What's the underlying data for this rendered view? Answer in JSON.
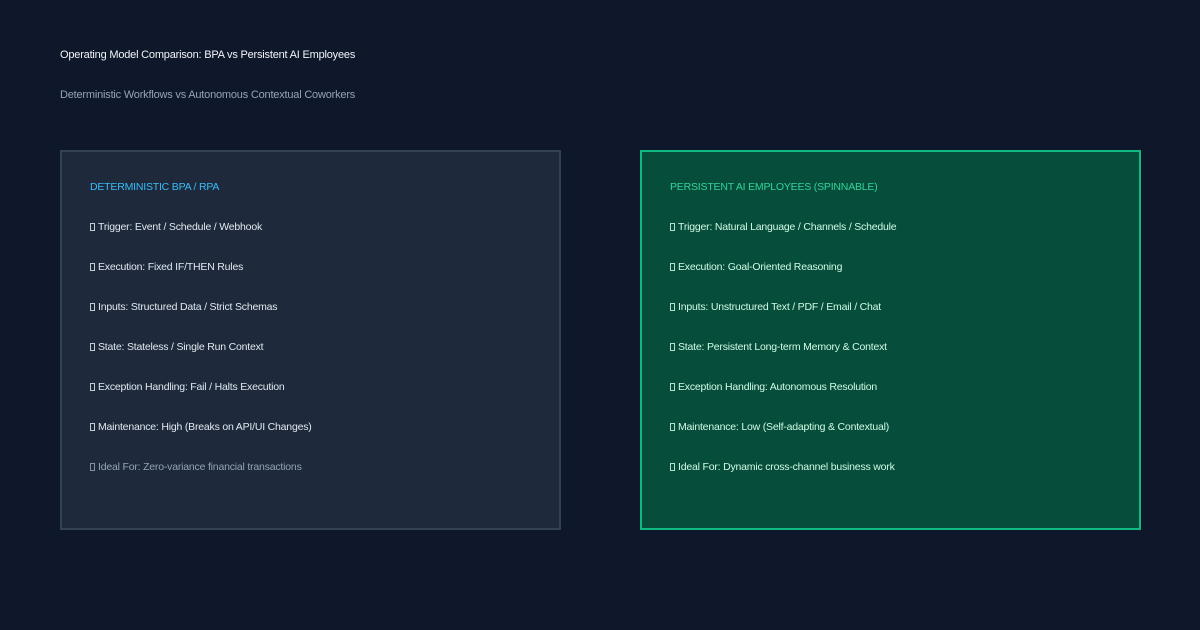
{
  "header": {
    "title": "Operating Model Comparison: BPA vs Persistent AI Employees",
    "subtitle": "Deterministic Workflows vs Autonomous Contextual Coworkers"
  },
  "colors": {
    "background": "#0f172a",
    "left_panel_fill": "#1e293b",
    "left_panel_border": "#334155",
    "left_accent": "#38bdf8",
    "right_panel_fill": "#064e3b",
    "right_panel_border": "#10b981",
    "right_accent": "#34d399"
  },
  "panels": {
    "left": {
      "heading": "DETERMINISTIC BPA / RPA",
      "items": [
        "Trigger: Event / Schedule / Webhook",
        "Execution: Fixed IF/THEN Rules",
        "Inputs: Structured Data / Strict Schemas",
        "State: Stateless / Single Run Context",
        "Exception Handling: Fail / Halts Execution",
        "Maintenance: High (Breaks on API/UI Changes)",
        "Ideal For: Zero-variance financial transactions"
      ]
    },
    "right": {
      "heading": "PERSISTENT AI EMPLOYEES (SPINNABLE)",
      "items": [
        "Trigger: Natural Language / Channels / Schedule",
        "Execution: Goal-Oriented Reasoning",
        "Inputs: Unstructured Text / PDF / Email / Chat",
        "State: Persistent Long-term Memory & Context",
        "Exception Handling: Autonomous Resolution",
        "Maintenance: Low (Self-adapting & Contextual)",
        "Ideal For: Dynamic cross-channel business work"
      ]
    }
  }
}
